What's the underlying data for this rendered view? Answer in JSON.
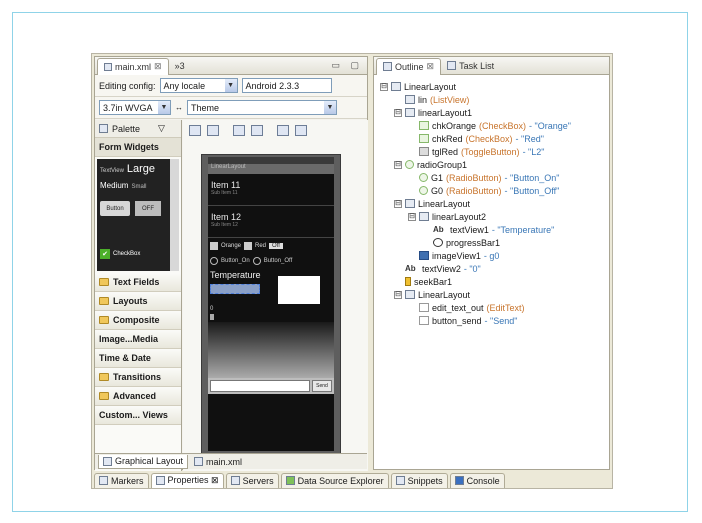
{
  "editor": {
    "tabs": [
      {
        "label": "main.xml",
        "close": "⊠"
      },
      {
        "label": "»3"
      }
    ],
    "window_controls": "▭ ▢",
    "editing_config_label": "Editing config:",
    "locale_value": "Any locale",
    "api_value": "Android 2.3.3",
    "device_value": "3.7in WVGA",
    "theme_value": "Theme"
  },
  "palette": {
    "header": "Palette",
    "form_widgets": "Form Widgets",
    "preview": {
      "text_view": "TextView",
      "large": "Large",
      "medium": "Medium",
      "small": "Small",
      "button": "Button",
      "off": "OFF",
      "checkbox": "CheckBox"
    },
    "sections": [
      "Text Fields",
      "Layouts",
      "Composite",
      "Image...Media",
      "Time & Date",
      "Transitions",
      "Advanced",
      "Custom... Views"
    ]
  },
  "device": {
    "title": "LinearLayout",
    "items": [
      {
        "title": "Item 11",
        "sub": "Sub Item 11"
      },
      {
        "title": "Item 12",
        "sub": "Sub Item 12"
      }
    ],
    "orange": "Orange",
    "red": "Red",
    "toggle": "Off",
    "radio_on": "Button_On",
    "radio_off": "Button_Off",
    "temperature": "Temperature",
    "text_zero": "0",
    "send": "Send"
  },
  "editor_bottom_tabs": [
    "Graphical Layout",
    "main.xml"
  ],
  "outline": {
    "tabs": [
      {
        "label": "Outline",
        "close": "⊠"
      },
      {
        "label": "Task List"
      }
    ],
    "nodes": [
      {
        "name": "LinearLayout",
        "type": "",
        "value": "",
        "depth": 0,
        "toggle": "⊟"
      },
      {
        "name": "lin",
        "type": "(ListView)",
        "value": "",
        "depth": 1,
        "toggle": ""
      },
      {
        "name": "linearLayout1",
        "type": "",
        "value": "",
        "depth": 1,
        "toggle": "⊟"
      },
      {
        "name": "chkOrange",
        "type": "(CheckBox)",
        "value": "- \"Orange\"",
        "depth": 2,
        "toggle": ""
      },
      {
        "name": "chkRed",
        "type": "(CheckBox)",
        "value": "- \"Red\"",
        "depth": 2,
        "toggle": ""
      },
      {
        "name": "tglRed",
        "type": "(ToggleButton)",
        "value": "- \"L2\"",
        "depth": 2,
        "toggle": ""
      },
      {
        "name": "radioGroup1",
        "type": "",
        "value": "",
        "depth": 1,
        "toggle": "⊟"
      },
      {
        "name": "G1",
        "type": "(RadioButton)",
        "value": "- \"Button_On\"",
        "depth": 2,
        "toggle": ""
      },
      {
        "name": "G0",
        "type": "(RadioButton)",
        "value": "- \"Button_Off\"",
        "depth": 2,
        "toggle": ""
      },
      {
        "name": "LinearLayout",
        "type": "",
        "value": "",
        "depth": 1,
        "toggle": "⊟"
      },
      {
        "name": "linearLayout2",
        "type": "",
        "value": "",
        "depth": 2,
        "toggle": "⊟"
      },
      {
        "name": "textView1",
        "type": "",
        "value": "- \"Temperature\"",
        "depth": 3,
        "toggle": "",
        "ab": "Ab"
      },
      {
        "name": "progressBar1",
        "type": "",
        "value": "",
        "depth": 3,
        "toggle": ""
      },
      {
        "name": "imageView1",
        "type": "",
        "value": "- g0",
        "depth": 2,
        "toggle": ""
      },
      {
        "name": "textView2",
        "type": "",
        "value": "- \"0\"",
        "depth": 1,
        "toggle": "",
        "ab": "Ab"
      },
      {
        "name": "seekBar1",
        "type": "",
        "value": "",
        "depth": 1,
        "toggle": ""
      },
      {
        "name": "LinearLayout",
        "type": "",
        "value": "",
        "depth": 1,
        "toggle": "⊟"
      },
      {
        "name": "edit_text_out",
        "type": "(EditText)",
        "value": "",
        "depth": 2,
        "toggle": ""
      },
      {
        "name": "button_send",
        "type": "",
        "value": "- \"Send\"",
        "depth": 2,
        "toggle": ""
      }
    ]
  },
  "view_tabs": [
    "Markers",
    "Properties ⊠",
    "Servers",
    "Data Source Explorer",
    "Snippets",
    "Console"
  ]
}
